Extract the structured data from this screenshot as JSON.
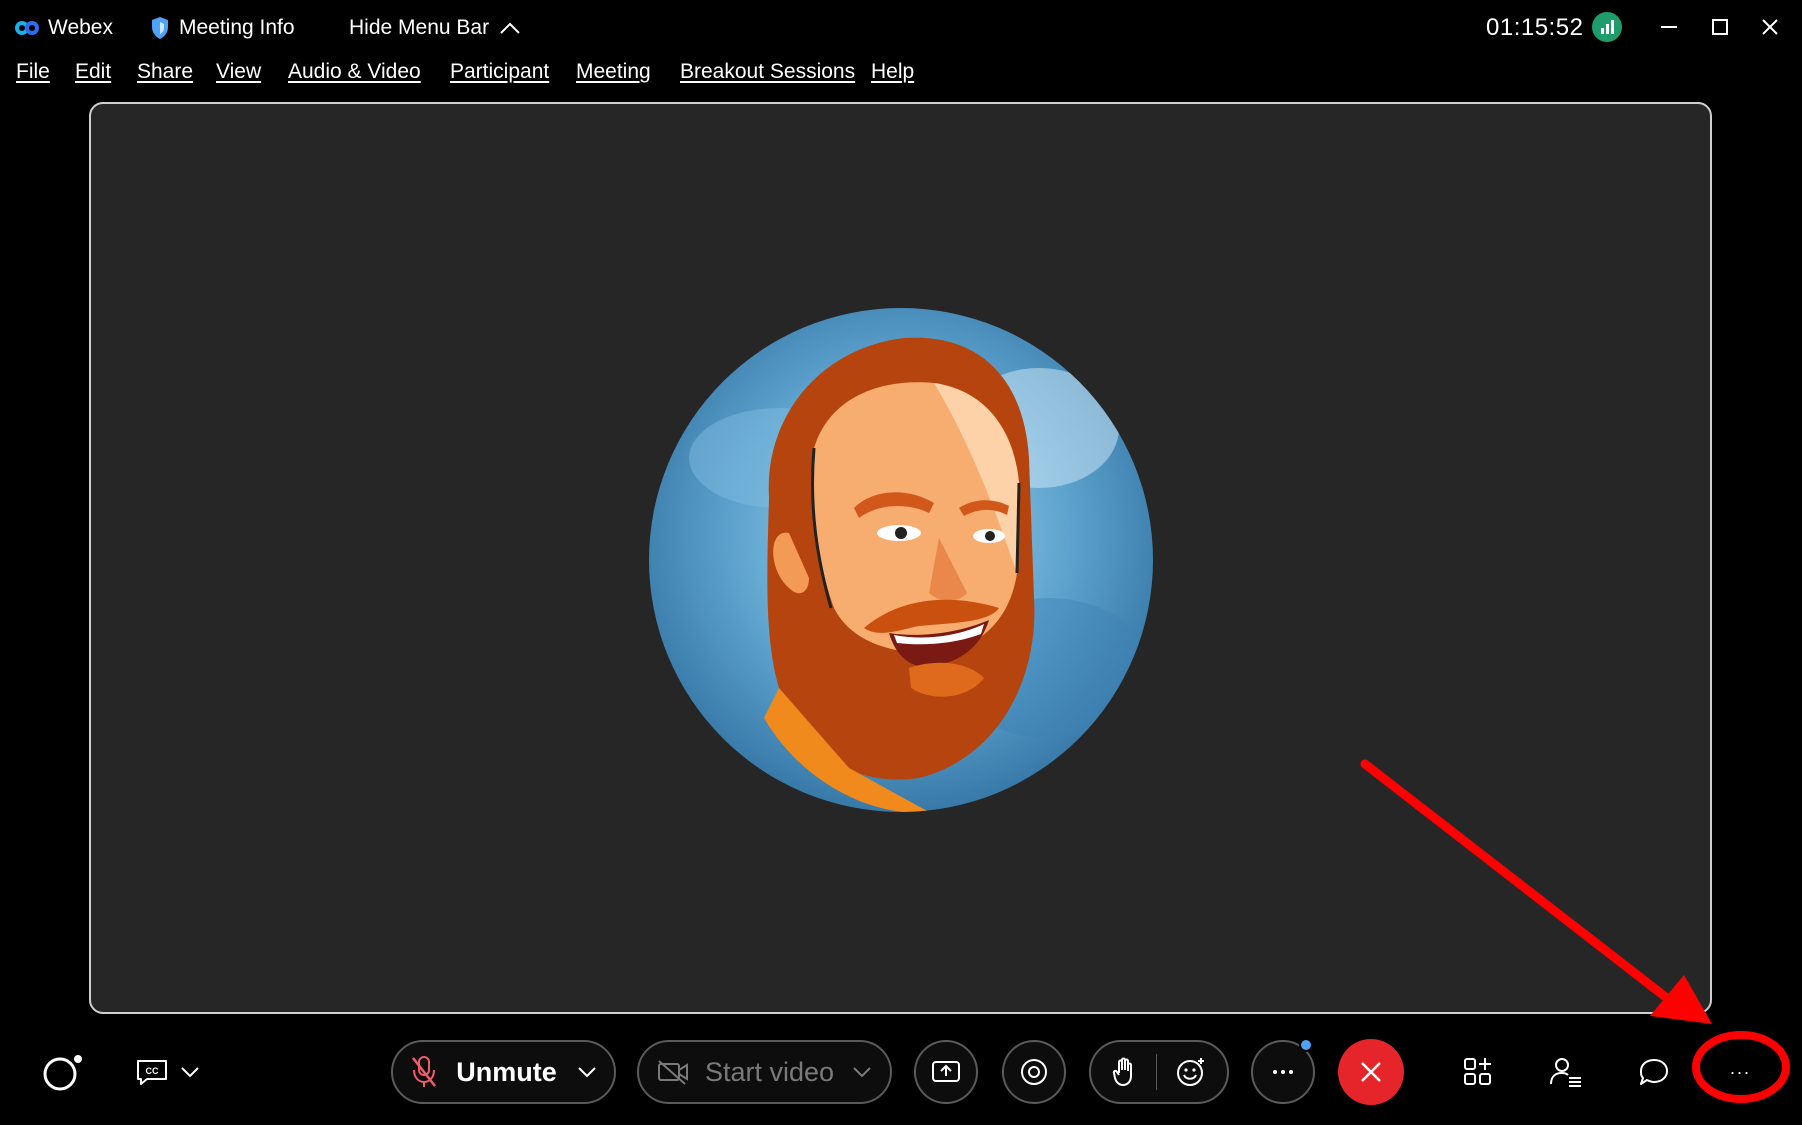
{
  "titlebar": {
    "app_name": "Webex",
    "meeting_info_label": "Meeting Info",
    "hide_menu_label": "Hide Menu Bar",
    "clock": "01:15:52"
  },
  "menu": {
    "items": [
      "File",
      "Edit",
      "Share",
      "View",
      "Audio & Video",
      "Participant",
      "Meeting",
      "Breakout Sessions",
      "Help"
    ]
  },
  "controls": {
    "unmute_label": "Unmute",
    "start_video_label": "Start video",
    "cc_label": "CC",
    "more_label": "···"
  },
  "colors": {
    "background": "#000000",
    "stage": "#262626",
    "end_call": "#e5252a",
    "annotation": "#ff0000",
    "network_ok": "#1e9c6a",
    "notification_dot": "#4ea3f7"
  },
  "icons": [
    "webex-logo-icon",
    "shield-icon",
    "chevron-up-icon",
    "signal-icon",
    "minimize-icon",
    "maximize-icon",
    "close-icon",
    "activity-icon",
    "closed-captions-icon",
    "microphone-muted-icon",
    "video-off-icon",
    "share-screen-icon",
    "record-icon",
    "raise-hand-icon",
    "reactions-icon",
    "more-icon",
    "end-call-icon",
    "apps-icon",
    "participants-icon",
    "chat-icon"
  ]
}
